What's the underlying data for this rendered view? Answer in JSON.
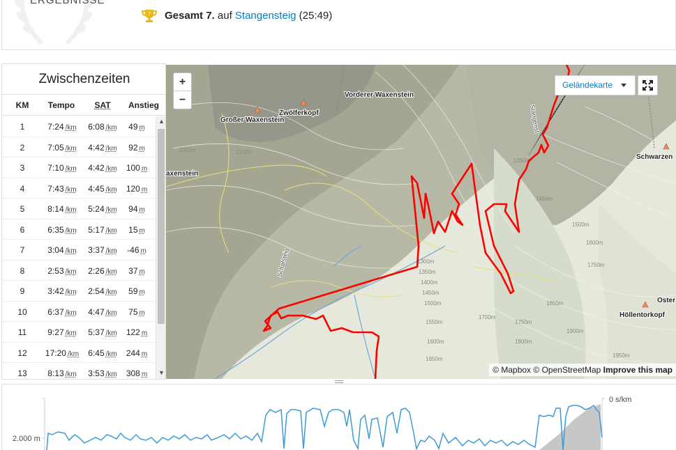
{
  "results": {
    "title": "ERGEBNISSE",
    "overall_label": "Gesamt 7.",
    "on_label": "auf",
    "segment_name": "Stangensteig",
    "segment_time": "(25:49)",
    "rank_badge": "7"
  },
  "splits": {
    "title": "Zwischenzeiten",
    "headers": {
      "km": "KM",
      "pace": "Tempo",
      "gap": "SAT",
      "elev": "Anstieg"
    },
    "unit_pace": "/km",
    "unit_elev": "m",
    "rows": [
      {
        "km": "1",
        "pace": "7:24",
        "gap": "6:08",
        "elev": "49"
      },
      {
        "km": "2",
        "pace": "7:05",
        "gap": "4:42",
        "elev": "92"
      },
      {
        "km": "3",
        "pace": "7:10",
        "gap": "4:42",
        "elev": "100"
      },
      {
        "km": "4",
        "pace": "7:43",
        "gap": "4:45",
        "elev": "120"
      },
      {
        "km": "5",
        "pace": "8:14",
        "gap": "5:24",
        "elev": "94"
      },
      {
        "km": "6",
        "pace": "6:35",
        "gap": "5:17",
        "elev": "15"
      },
      {
        "km": "7",
        "pace": "3:04",
        "gap": "3:37",
        "elev": "-46"
      },
      {
        "km": "8",
        "pace": "2:53",
        "gap": "2:26",
        "elev": "37"
      },
      {
        "km": "9",
        "pace": "3:42",
        "gap": "2:54",
        "elev": "59"
      },
      {
        "km": "10",
        "pace": "6:37",
        "gap": "4:47",
        "elev": "75"
      },
      {
        "km": "11",
        "pace": "9:27",
        "gap": "5:37",
        "elev": "122"
      },
      {
        "km": "12",
        "pace": "17:20",
        "gap": "6:45",
        "elev": "244"
      },
      {
        "km": "13",
        "pace": "8:13",
        "gap": "3:53",
        "elev": "308"
      }
    ]
  },
  "map": {
    "zoom_in": "+",
    "zoom_out": "−",
    "style_button": "Geländekarte",
    "attribution_mapbox": "© Mapbox",
    "attribution_osm": "© OpenStreetMap",
    "attribution_improve": "Improve this map",
    "places": {
      "vorderer": "Vorderer Waxenstein",
      "zwoelfer": "Zwölferkopf",
      "grosser": "Großer Waxenstein",
      "waxenstein": "axenstein",
      "schwarzen": "Schwarzen",
      "hoellentor": "Höllentorkopf",
      "oster": "Oster",
      "schafsteig": "Schafsteig",
      "stangensteig": "Stangenst"
    },
    "contours": {
      "c1350": "1350m",
      "c1400": "1400m",
      "c1450": "1450m",
      "c1500": "1500m",
      "c1550": "1550m",
      "c1600": "1600m",
      "c1650": "1650m",
      "c1700": "1700m",
      "c1750": "1750m",
      "c1800": "1800m",
      "c1850": "1850m",
      "c1900": "1900m",
      "c1950": "1950m",
      "c2050": "2050m",
      "c2100": "2100m",
      "c1300": "1300m",
      "c1250": "1250m"
    },
    "route_color": "#ff0000"
  },
  "elevation": {
    "y_label": "2.000 m",
    "pace_label": "0 s/km",
    "line_color": "#3b9bd6"
  }
}
